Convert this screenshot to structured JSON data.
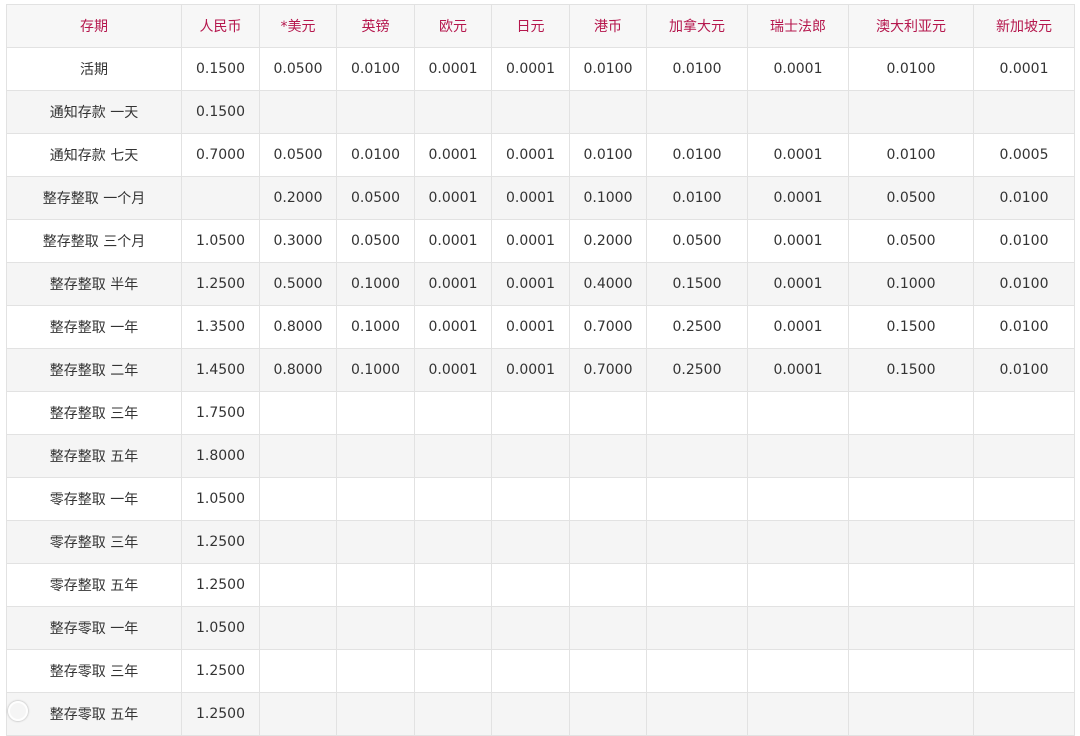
{
  "table": {
    "headers": [
      "存期",
      "人民币",
      "*美元",
      "英镑",
      "欧元",
      "日元",
      "港币",
      "加拿大元",
      "瑞士法郎",
      "澳大利亚元",
      "新加坡元"
    ],
    "rows": [
      [
        "活期",
        "0.1500",
        "0.0500",
        "0.0100",
        "0.0001",
        "0.0001",
        "0.0100",
        "0.0100",
        "0.0001",
        "0.0100",
        "0.0001"
      ],
      [
        "通知存款 一天",
        "0.1500",
        "",
        "",
        "",
        "",
        "",
        "",
        "",
        "",
        ""
      ],
      [
        "通知存款 七天",
        "0.7000",
        "0.0500",
        "0.0100",
        "0.0001",
        "0.0001",
        "0.0100",
        "0.0100",
        "0.0001",
        "0.0100",
        "0.0005"
      ],
      [
        "整存整取 一个月",
        "",
        "0.2000",
        "0.0500",
        "0.0001",
        "0.0001",
        "0.1000",
        "0.0100",
        "0.0001",
        "0.0500",
        "0.0100"
      ],
      [
        "整存整取 三个月",
        "1.0500",
        "0.3000",
        "0.0500",
        "0.0001",
        "0.0001",
        "0.2000",
        "0.0500",
        "0.0001",
        "0.0500",
        "0.0100"
      ],
      [
        "整存整取 半年",
        "1.2500",
        "0.5000",
        "0.1000",
        "0.0001",
        "0.0001",
        "0.4000",
        "0.1500",
        "0.0001",
        "0.1000",
        "0.0100"
      ],
      [
        "整存整取 一年",
        "1.3500",
        "0.8000",
        "0.1000",
        "0.0001",
        "0.0001",
        "0.7000",
        "0.2500",
        "0.0001",
        "0.1500",
        "0.0100"
      ],
      [
        "整存整取 二年",
        "1.4500",
        "0.8000",
        "0.1000",
        "0.0001",
        "0.0001",
        "0.7000",
        "0.2500",
        "0.0001",
        "0.1500",
        "0.0100"
      ],
      [
        "整存整取 三年",
        "1.7500",
        "",
        "",
        "",
        "",
        "",
        "",
        "",
        "",
        ""
      ],
      [
        "整存整取 五年",
        "1.8000",
        "",
        "",
        "",
        "",
        "",
        "",
        "",
        "",
        ""
      ],
      [
        "零存整取 一年",
        "1.0500",
        "",
        "",
        "",
        "",
        "",
        "",
        "",
        "",
        ""
      ],
      [
        "零存整取 三年",
        "1.2500",
        "",
        "",
        "",
        "",
        "",
        "",
        "",
        "",
        ""
      ],
      [
        "零存整取 五年",
        "1.2500",
        "",
        "",
        "",
        "",
        "",
        "",
        "",
        "",
        ""
      ],
      [
        "整存零取 一年",
        "1.0500",
        "",
        "",
        "",
        "",
        "",
        "",
        "",
        "",
        ""
      ],
      [
        "整存零取 三年",
        "1.2500",
        "",
        "",
        "",
        "",
        "",
        "",
        "",
        "",
        ""
      ],
      [
        "整存零取 五年",
        "1.2500",
        "",
        "",
        "",
        "",
        "",
        "",
        "",
        "",
        ""
      ]
    ]
  },
  "colors": {
    "header_text": "#b5174d",
    "body_text": "#333333",
    "border": "#e2e2e2",
    "stripe": "#f5f5f5"
  },
  "watermark": {
    "icon": "watermark-logo-icon"
  }
}
